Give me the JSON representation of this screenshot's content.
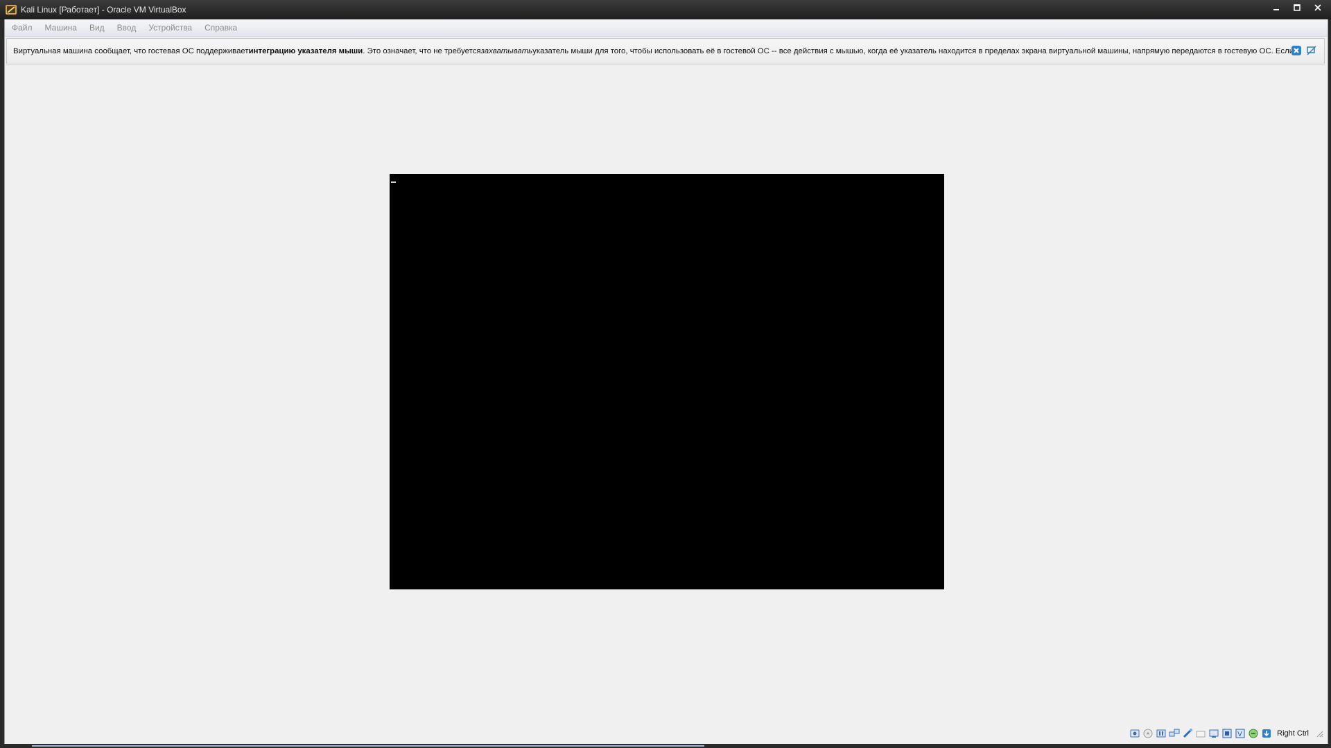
{
  "window": {
    "title": "Kali Linux [Работает] - Oracle VM VirtualBox",
    "controls": {
      "minimize": "–",
      "maximize": "□",
      "close": "✕"
    }
  },
  "menu": {
    "items": [
      "Файл",
      "Машина",
      "Вид",
      "Ввод",
      "Устройства",
      "Справка"
    ]
  },
  "notice": {
    "part1": "Виртуальная машина сообщает, что гостевая ОС поддерживает ",
    "bold": "интеграцию указателя мыши",
    "part2": ". Это означает, что не требуется ",
    "italic": "захватывать",
    "part3": " указатель мыши для того, чтобы использовать её в гостевой ОС -- все действия с мышью, когда её указатель находится в пределах экрана виртуальной машины, напрямую передаются в гостевую ОС. Если"
  },
  "status": {
    "host_key": "Right Ctrl",
    "icons": [
      "hard-disk-icon",
      "optical-drive-icon",
      "audio-icon",
      "network-icon",
      "usb-icon",
      "shared-folders-icon",
      "display-icon",
      "video-capture-icon",
      "virtualization-icon",
      "mouse-integration-icon",
      "keyboard-capture-icon"
    ]
  }
}
